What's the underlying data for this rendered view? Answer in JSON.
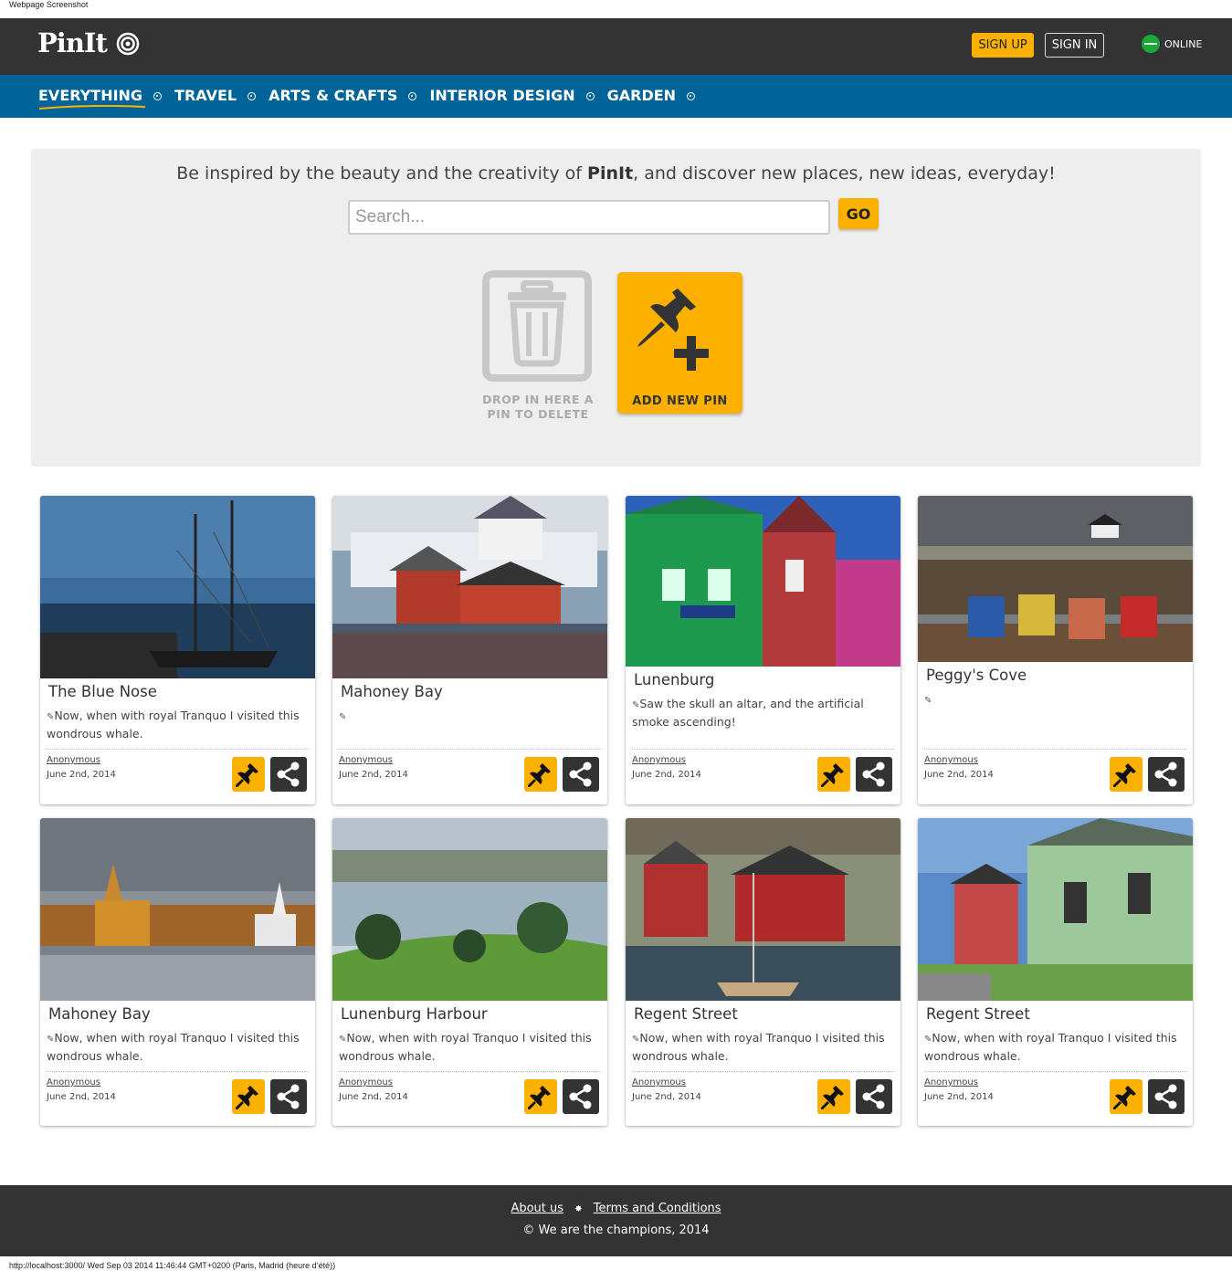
{
  "screenshot_label": "Webpage Screenshot",
  "header": {
    "logo": "PinIt",
    "signup_label": "SIGN UP",
    "signin_label": "SIGN IN",
    "status_label": "ONLINE",
    "status_color": "#1aaa3a"
  },
  "nav": {
    "items": [
      {
        "label": "EVERYTHING",
        "active": true
      },
      {
        "label": "TRAVEL"
      },
      {
        "label": "ARTS & CRAFTS"
      },
      {
        "label": "INTERIOR DESIGN"
      },
      {
        "label": "GARDEN"
      }
    ]
  },
  "hero": {
    "tagline_before": "Be inspired by the beauty and the creativity of ",
    "tagline_brand": "PinIt",
    "tagline_after": ", and discover new places, new ideas, everyday!",
    "search_placeholder": "Search...",
    "go_label": "GO",
    "trash_label_line1": "DROP IN HERE A",
    "trash_label_line2": "PIN TO DELETE",
    "add_pin_label": "ADD NEW PIN"
  },
  "cards": [
    {
      "title": "The Blue Nose",
      "desc": "Now, when with royal Tranquo I visited this wondrous whale.",
      "author": "Anonymous",
      "date": "June 2nd, 2014"
    },
    {
      "title": "Mahoney Bay",
      "desc": "",
      "author": "Anonymous",
      "date": "June 2nd, 2014"
    },
    {
      "title": "Lunenburg",
      "desc": "Saw the skull an altar, and the artificial smoke ascending!",
      "author": "Anonymous",
      "date": "June 2nd, 2014"
    },
    {
      "title": "Peggy's Cove",
      "desc": "",
      "author": "Anonymous",
      "date": "June 2nd, 2014"
    },
    {
      "title": "Mahoney Bay",
      "desc": "Now, when with royal Tranquo I visited this wondrous whale.",
      "author": "Anonymous",
      "date": "June 2nd, 2014"
    },
    {
      "title": "Lunenburg Harbour",
      "desc": "Now, when with royal Tranquo I visited this wondrous whale.",
      "author": "Anonymous",
      "date": "June 2nd, 2014"
    },
    {
      "title": "Regent Street",
      "desc": "Now, when with royal Tranquo I visited this wondrous whale.",
      "author": "Anonymous",
      "date": "June 2nd, 2014"
    },
    {
      "title": "Regent Street",
      "desc": "Now, when with royal Tranquo I visited this wondrous whale.",
      "author": "Anonymous",
      "date": "June 2nd, 2014"
    }
  ],
  "footer": {
    "about_label": "About us",
    "terms_label": "Terms and Conditions",
    "copyright": "© We are the champions, 2014"
  },
  "status_url": "http://localhost:3000/ Wed Sep 03 2014 11:46:44 GMT+0200 (Paris, Madrid (heure d’été))",
  "colors": {
    "accent": "#fcb100",
    "nav": "#006499",
    "dark": "#333333"
  }
}
